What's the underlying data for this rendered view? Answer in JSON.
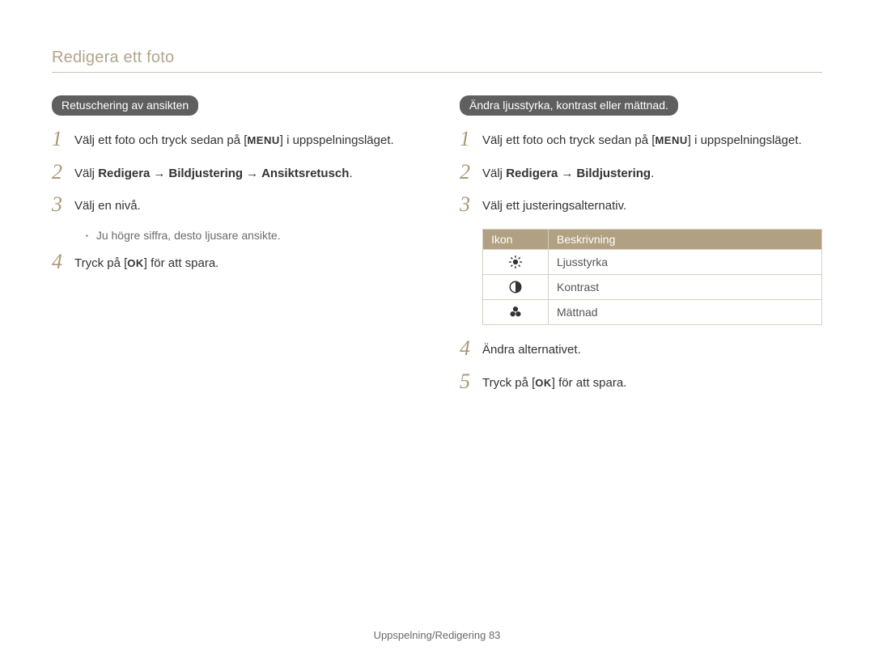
{
  "page_title": "Redigera ett foto",
  "footer_section": "Uppspelning/Redigering",
  "footer_page": "83",
  "buttons": {
    "menu": "MENU",
    "ok": "OK"
  },
  "left": {
    "heading": "Retuschering av ansikten",
    "steps": {
      "s1": {
        "num": "1",
        "pre": "Välj ett foto och tryck sedan på [",
        "post": "] i uppspelningsläget."
      },
      "s2": {
        "num": "2",
        "pre": "Välj ",
        "bold1": "Redigera",
        "bold2": "Bildjustering",
        "bold3": "Ansiktsretusch",
        "suffix": "."
      },
      "s3": {
        "num": "3",
        "text": "Välj en nivå."
      },
      "note1": "Ju högre siffra, desto ljusare ansikte.",
      "s4": {
        "num": "4",
        "pre": "Tryck på [",
        "post": "] för att spara."
      }
    }
  },
  "right": {
    "heading": "Ändra ljusstyrka, kontrast eller mättnad.",
    "steps": {
      "s1": {
        "num": "1",
        "pre": "Välj ett foto och tryck sedan på [",
        "post": "] i uppspelningsläget."
      },
      "s2": {
        "num": "2",
        "pre": "Välj ",
        "bold1": "Redigera",
        "bold2": "Bildjustering",
        "suffix": "."
      },
      "s3": {
        "num": "3",
        "text": "Välj ett justeringsalternativ."
      },
      "s4": {
        "num": "4",
        "text": "Ändra alternativet."
      },
      "s5": {
        "num": "5",
        "pre": "Tryck på [",
        "post": "] för att spara."
      }
    },
    "table": {
      "head_icon": "Ikon",
      "head_desc": "Beskrivning",
      "rows": [
        {
          "icon": "brightness",
          "desc": "Ljusstyrka"
        },
        {
          "icon": "contrast",
          "desc": "Kontrast"
        },
        {
          "icon": "saturation",
          "desc": "Mättnad"
        }
      ]
    }
  }
}
